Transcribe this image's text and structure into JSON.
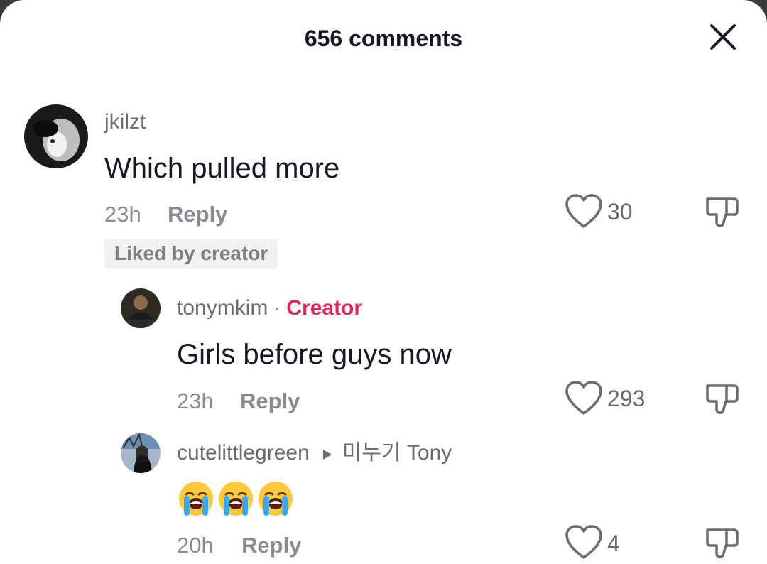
{
  "header": {
    "title": "656 comments"
  },
  "comments": [
    {
      "username": "jkilzt",
      "text": "Which pulled more",
      "time": "23h",
      "reply_label": "Reply",
      "likes": "30",
      "badge": "Liked by creator"
    },
    {
      "username": "tonymkim",
      "separator": "·",
      "creator_label": "Creator",
      "text": "Girls before guys now",
      "time": "23h",
      "reply_label": "Reply",
      "likes": "293"
    },
    {
      "username": "cutelittlegreen",
      "reply_to": "미누기 Tony",
      "text_emoji": "loudly-crying-face x3",
      "time": "20h",
      "reply_label": "Reply",
      "likes": "4"
    }
  ],
  "colors": {
    "creator": "#e0275c",
    "text": "#161823",
    "muted": "#8a8b91"
  },
  "icons": [
    "close-icon",
    "heart-icon",
    "thumbs-down-icon",
    "play-arrow-icon",
    "loudly-crying-face-emoji"
  ]
}
